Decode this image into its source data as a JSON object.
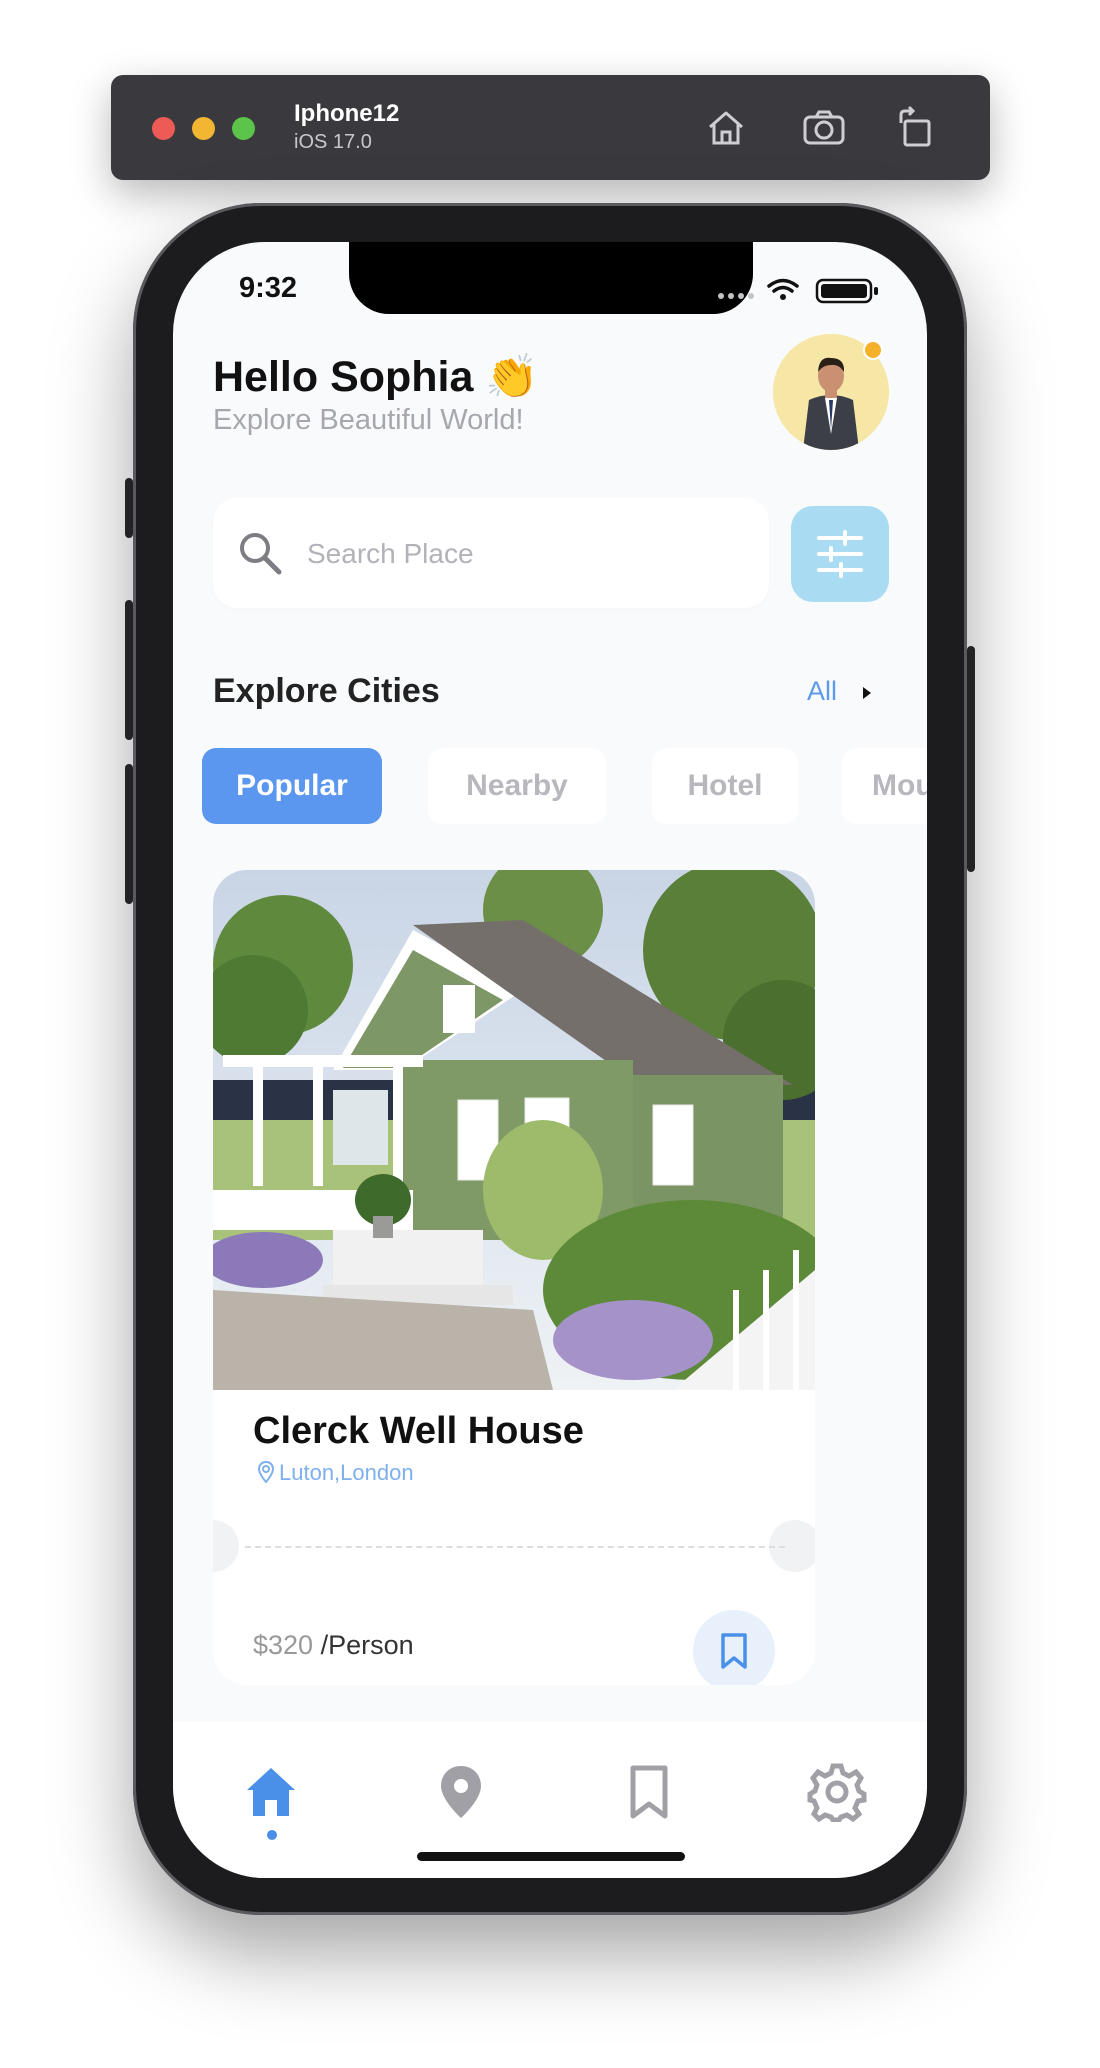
{
  "simulator": {
    "device_name": "Iphone12",
    "os_version": "iOS 17.0"
  },
  "status_bar": {
    "time": "9:32"
  },
  "header": {
    "greeting": "Hello Sophia 👏",
    "subtitle": "Explore Beautiful World!"
  },
  "search": {
    "placeholder": "Search Place",
    "value": ""
  },
  "explore": {
    "title": "Explore Cities",
    "all_label": "All"
  },
  "categories": [
    {
      "label": "Popular",
      "active": true
    },
    {
      "label": "Nearby",
      "active": false
    },
    {
      "label": "Hotel",
      "active": false
    },
    {
      "label": "Mou",
      "active": false
    }
  ],
  "card": {
    "title": "Clerck Well House",
    "location": "Luton,London",
    "price": "$320",
    "price_unit": "/Person"
  },
  "colors": {
    "accent": "#5b96ef",
    "filter_bg": "#a9dcf3",
    "active_tab": "#4a90e8",
    "inactive_tab": "#a0a0a6"
  },
  "tabbar": {
    "items": [
      {
        "icon": "home-icon",
        "active": true
      },
      {
        "icon": "location-pin-icon",
        "active": false
      },
      {
        "icon": "bookmark-icon",
        "active": false
      },
      {
        "icon": "gear-icon",
        "active": false
      }
    ]
  }
}
